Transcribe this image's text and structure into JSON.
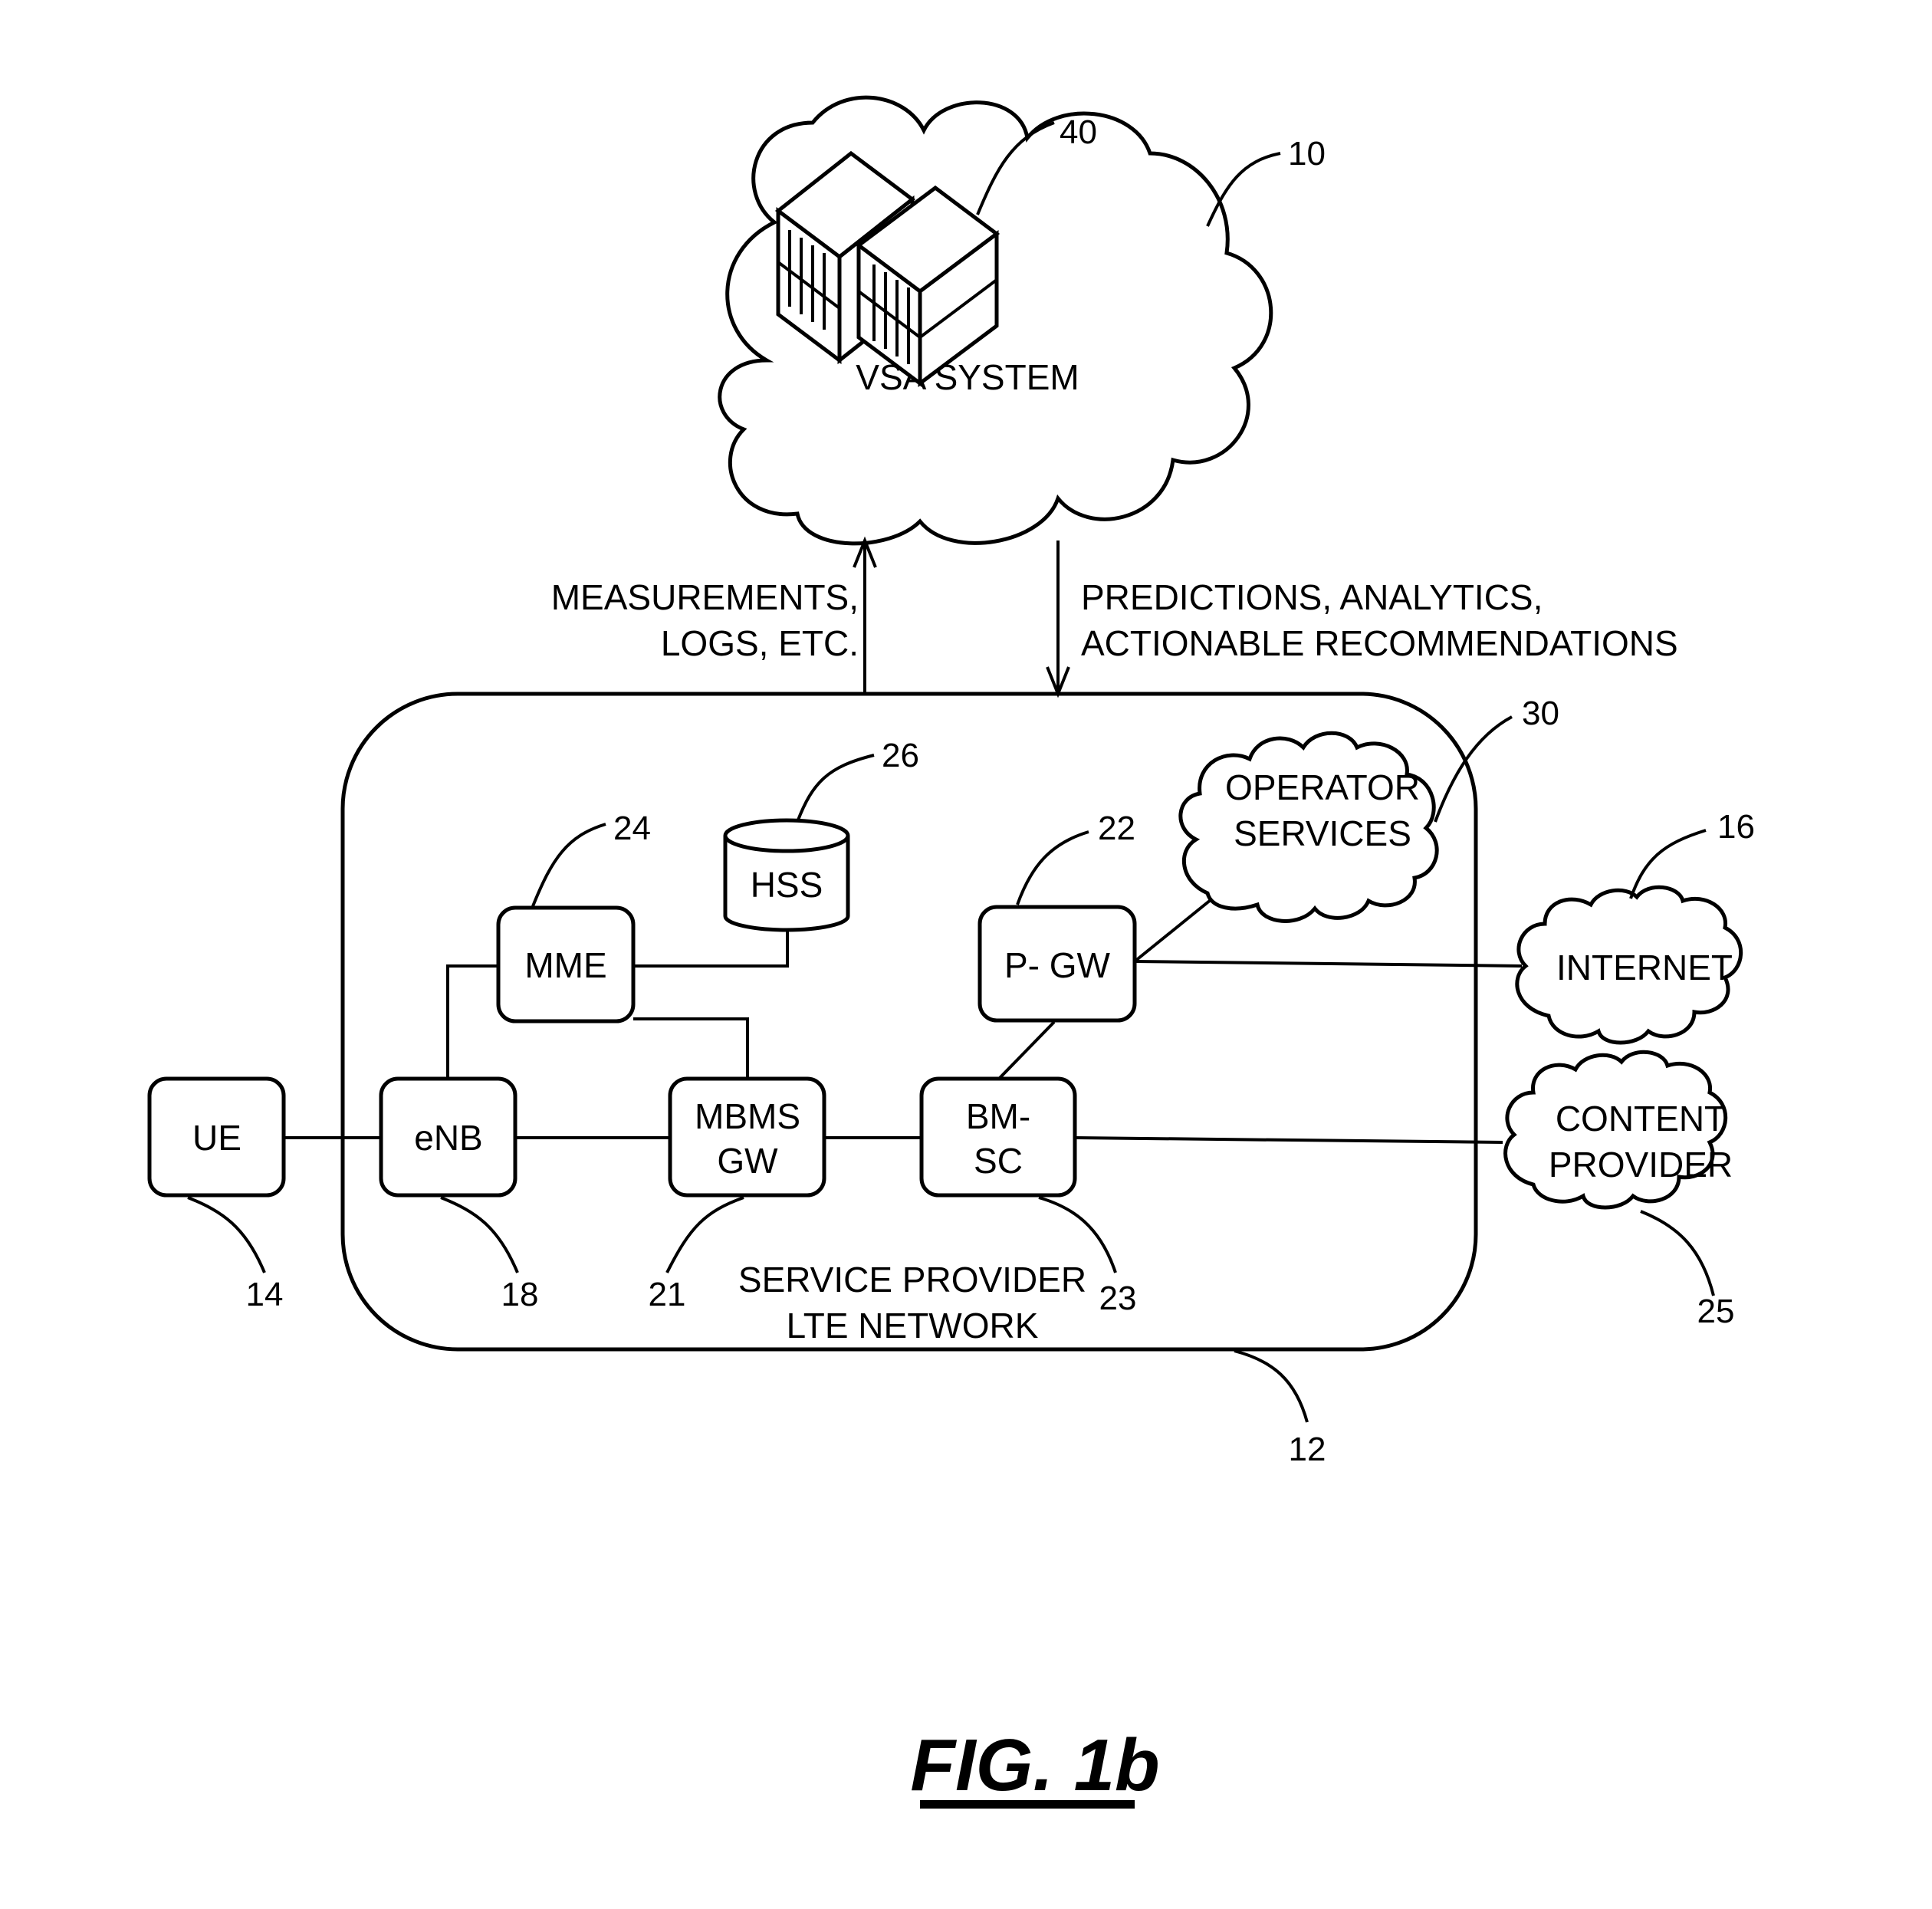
{
  "figure": {
    "title": "FIG. 1b"
  },
  "cloud_vsa": {
    "label": "VSA SYSTEM",
    "ref": "10",
    "server_ref": "40"
  },
  "arrows": {
    "up_label_line1": "MEASUREMENTS,",
    "up_label_line2": "LOGS, ETC.",
    "down_label_line1": "PREDICTIONS, ANALYTICS,",
    "down_label_line2": "ACTIONABLE RECOMMENDATIONS"
  },
  "network": {
    "label_line1": "SERVICE PROVIDER",
    "label_line2": "LTE NETWORK",
    "ref": "12"
  },
  "nodes": {
    "ue": {
      "label": "UE",
      "ref": "14"
    },
    "enb": {
      "label": "eNB",
      "ref": "18"
    },
    "mme": {
      "label": "MME",
      "ref": "24"
    },
    "hss": {
      "label": "HSS",
      "ref": "26"
    },
    "mbms": {
      "label_line1": "MBMS",
      "label_line2": "GW",
      "ref": "21"
    },
    "bmsc": {
      "label_line1": "BM-",
      "label_line2": "SC",
      "ref": "23"
    },
    "pgw": {
      "label": "P- GW",
      "ref": "22"
    },
    "operator": {
      "label_line1": "OPERATOR",
      "label_line2": "SERVICES",
      "ref": "30"
    },
    "internet": {
      "label": "INTERNET",
      "ref": "16"
    },
    "content": {
      "label_line1": "CONTENT",
      "label_line2": "PROVIDER",
      "ref": "25"
    }
  }
}
